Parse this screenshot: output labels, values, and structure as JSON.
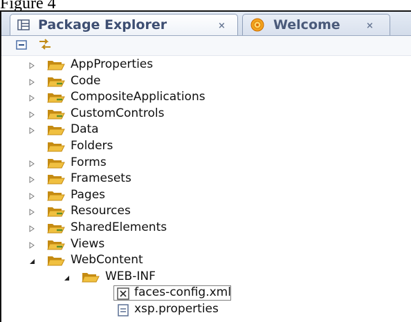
{
  "caption": "Figure 4",
  "tabs": [
    {
      "label": "Package Explorer",
      "icon": "package-explorer-icon",
      "active": true,
      "close": "×"
    },
    {
      "label": "Welcome",
      "icon": "welcome-icon",
      "active": false,
      "close": "×"
    }
  ],
  "toolbar": {
    "collapse_all_icon": "collapse-all-icon",
    "link_with_editor_icon": "link-with-editor-icon"
  },
  "tree": [
    {
      "label": "AppProperties",
      "icon": "folder-open-icon",
      "expander": "collapsed",
      "level": 0
    },
    {
      "label": "Code",
      "icon": "folder-code-icon",
      "expander": "collapsed",
      "level": 0
    },
    {
      "label": "CompositeApplications",
      "icon": "folder-code-icon",
      "expander": "collapsed",
      "level": 0
    },
    {
      "label": "CustomControls",
      "icon": "folder-code-icon",
      "expander": "collapsed",
      "level": 0
    },
    {
      "label": "Data",
      "icon": "folder-open-icon",
      "expander": "collapsed",
      "level": 0
    },
    {
      "label": "Folders",
      "icon": "folder-open-icon",
      "expander": "none",
      "level": 0
    },
    {
      "label": "Forms",
      "icon": "folder-open-icon",
      "expander": "collapsed",
      "level": 0
    },
    {
      "label": "Framesets",
      "icon": "folder-open-icon",
      "expander": "collapsed",
      "level": 0
    },
    {
      "label": "Pages",
      "icon": "folder-open-icon",
      "expander": "collapsed",
      "level": 0
    },
    {
      "label": "Resources",
      "icon": "folder-code-icon",
      "expander": "collapsed",
      "level": 0
    },
    {
      "label": "SharedElements",
      "icon": "folder-code-icon",
      "expander": "collapsed",
      "level": 0
    },
    {
      "label": "Views",
      "icon": "folder-code-icon",
      "expander": "collapsed",
      "level": 0
    },
    {
      "label": "WebContent",
      "icon": "folder-open-icon",
      "expander": "expanded",
      "level": 0
    },
    {
      "label": "WEB-INF",
      "icon": "folder-open-icon",
      "expander": "expanded",
      "level": 1
    },
    {
      "label": "faces-config.xml",
      "icon": "xml-file-icon",
      "expander": "none",
      "level": 2,
      "selected": true
    },
    {
      "label": "xsp.properties",
      "icon": "properties-file-icon",
      "expander": "none",
      "level": 2
    }
  ],
  "colors": {
    "tab_text": "#3d4e72",
    "folder": "#f0c040",
    "folder_dark": "#c58b12",
    "code_folder_badge": "#5b8f2a"
  }
}
